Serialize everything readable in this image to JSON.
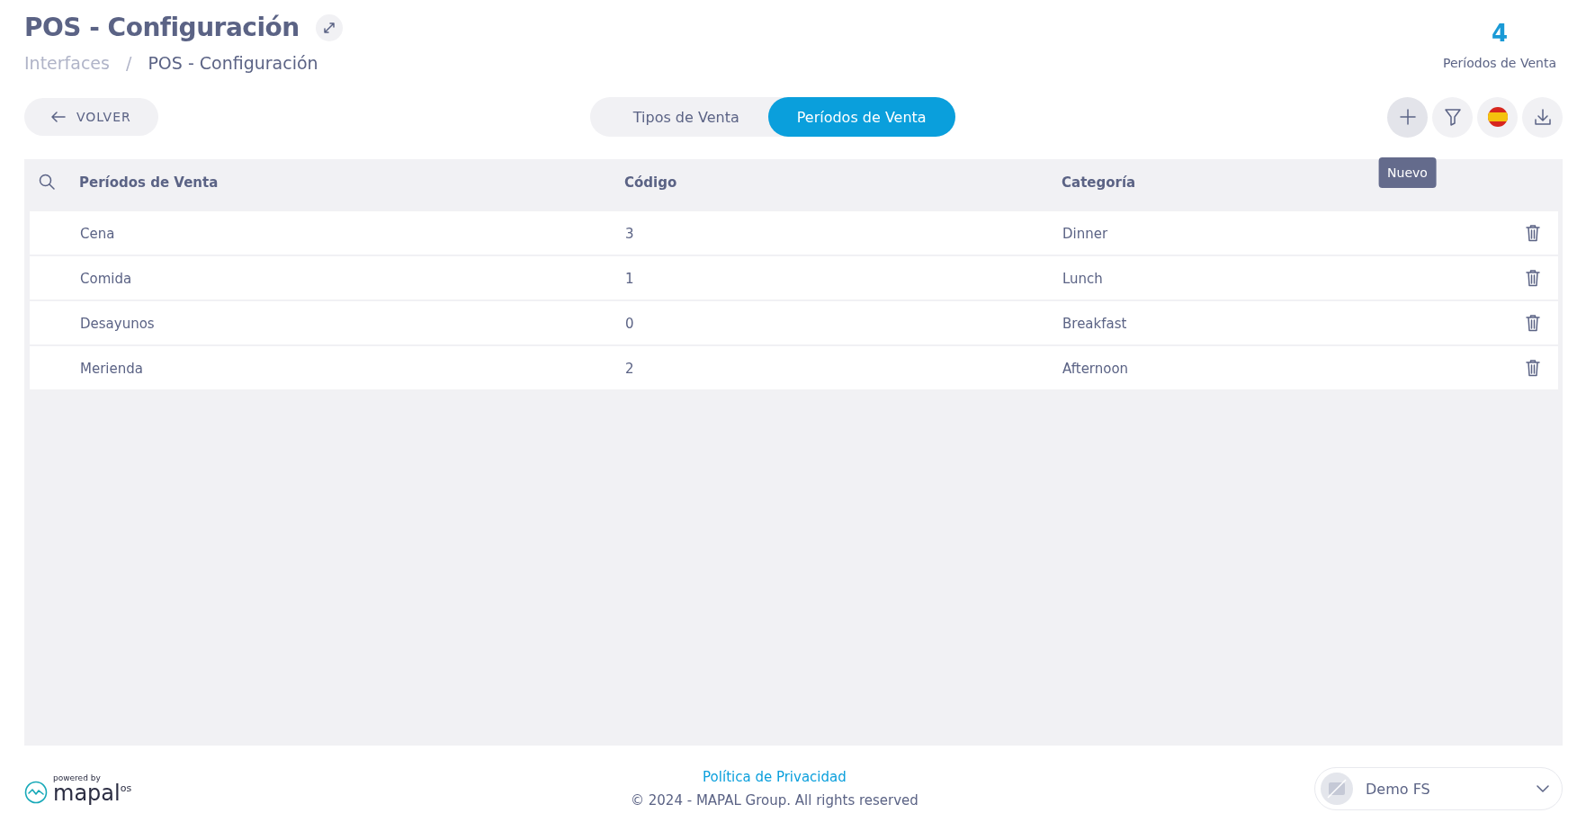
{
  "header": {
    "title": "POS - Configuración",
    "breadcrumb_separator": "/",
    "breadcrumb": [
      {
        "label": "Interfaces",
        "current": false
      },
      {
        "label": "POS - Configuración",
        "current": true
      }
    ],
    "counter": {
      "value": "4",
      "label": "Períodos de Venta"
    }
  },
  "back_button": {
    "label": "VOLVER"
  },
  "tabs": [
    {
      "label": "Tipos de Venta",
      "selected": false
    },
    {
      "label": "Períodos de Venta",
      "selected": true
    }
  ],
  "toolbar": [
    {
      "kind": "add",
      "hovered": true,
      "tooltip": "Nuevo"
    },
    {
      "kind": "filter",
      "hovered": false
    },
    {
      "kind": "language",
      "hovered": false
    },
    {
      "kind": "download",
      "hovered": false
    }
  ],
  "table": {
    "columns": [
      "Períodos de Venta",
      "Código",
      "Categoría"
    ],
    "rows": [
      [
        "Cena",
        "3",
        "Dinner"
      ],
      [
        "Comida",
        "1",
        "Lunch"
      ],
      [
        "Desayunos",
        "0",
        "Breakfast"
      ],
      [
        "Merienda",
        "2",
        "Afternoon"
      ]
    ]
  },
  "footer": {
    "powered_by": "powered by",
    "brand": "mapal",
    "brand_suffix": "os",
    "privacy_link": "Política de Privacidad",
    "copyright": "© 2024 - MAPAL Group. All rights reserved",
    "account": "Demo FS"
  }
}
